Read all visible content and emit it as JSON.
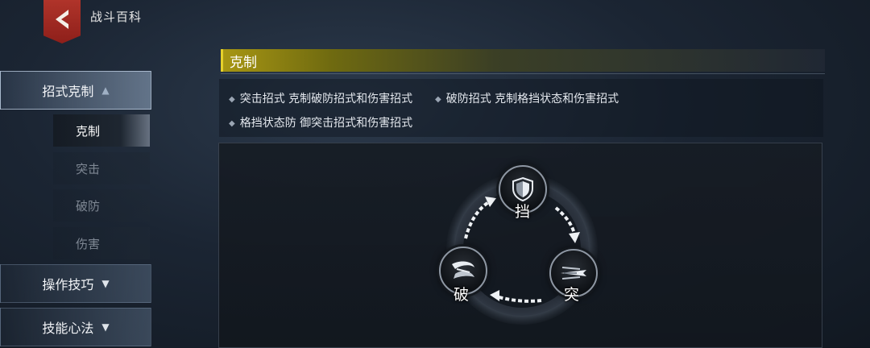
{
  "header": {
    "title": "战斗百科",
    "back_icon": "back-arrow-icon",
    "back_color": "#a92b24"
  },
  "sidebar": {
    "categories": [
      {
        "label": "招式克制",
        "expanded": true,
        "subitems": [
          {
            "label": "克制",
            "selected": true
          },
          {
            "label": "突击",
            "selected": false
          },
          {
            "label": "破防",
            "selected": false
          },
          {
            "label": "伤害",
            "selected": false
          }
        ]
      },
      {
        "label": "操作技巧",
        "expanded": false
      },
      {
        "label": "技能心法",
        "expanded": false
      }
    ]
  },
  "section": {
    "title": "克制",
    "accent_color": "#e6d12a"
  },
  "rules": [
    "突击招式 克制破防招式和伤害招式",
    "破防招式 克制格挡状态和伤害招式",
    "格挡状态防 御突击招式和伤害招式"
  ],
  "diagram": {
    "nodes": [
      {
        "label": "挡",
        "icon": "shield-icon"
      },
      {
        "label": "突",
        "icon": "thrust-icon"
      },
      {
        "label": "破",
        "icon": "break-icon"
      }
    ],
    "arrows": [
      "挡→突",
      "突→破",
      "破→挡"
    ]
  }
}
